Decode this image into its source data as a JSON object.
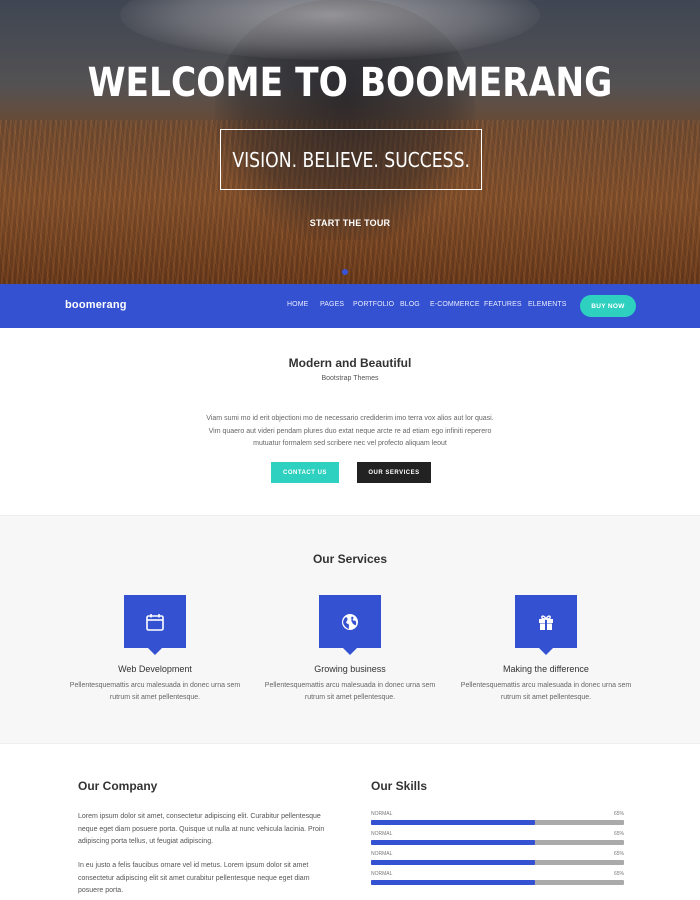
{
  "hero": {
    "title": "WELCOME TO BOOMERANG",
    "tagline": "VISION. BELIEVE. SUCCESS.",
    "link_label": "START THE TOUR"
  },
  "navbar": {
    "logo": "boomerang",
    "items": [
      {
        "label": "HOME"
      },
      {
        "label": "PAGES"
      },
      {
        "label": "PORTFOLIO"
      },
      {
        "label": "BLOG"
      },
      {
        "label": "E-COMMERCE"
      },
      {
        "label": "FEATURES"
      },
      {
        "label": "ELEMENTS"
      }
    ],
    "cta_label": "BUY NOW"
  },
  "intro": {
    "title": "Modern and Beautiful",
    "subtitle": "Bootstrap Themes",
    "text": "Viam sumi mo id erit objectioni mo de necessario crediderim imo terra vox alios aut lor quasi. Vim quaero aut videri pendam plures duo extat neque arcte re ad etiam ego infiniti reperero mutuatur formalem sed scribere nec vel profecto aliquam leout",
    "contact_label": "CONTACT US",
    "services_label": "OUR SERVICES"
  },
  "services": {
    "title": "Our Services",
    "items": [
      {
        "icon": "calendar-icon",
        "name": "Web Development",
        "description": "Pellentesquemattis arcu malesuada in donec urna sem rutrum sit amet pellentesque."
      },
      {
        "icon": "globe-icon",
        "name": "Growing business",
        "description": "Pellentesquemattis arcu malesuada in donec urna sem rutrum sit amet pellentesque."
      },
      {
        "icon": "gift-icon",
        "name": "Making the difference",
        "description": "Pellentesquemattis arcu malesuada in donec urna sem rutrum sit amet pellentesque."
      }
    ]
  },
  "company": {
    "title": "Our Company",
    "paragraphs": [
      "Lorem ipsum dolor sit amet, consectetur adipiscing elit. Curabitur pellentesque neque eget diam posuere porta. Quisque ut nulla at nunc vehicula lacinia. Proin adipiscing porta tellus, ut feugiat adipiscing.",
      "In eu justo a felis faucibus ornare vel id metus. Lorem ipsum dolor sit amet consectetur adipiscing elit sit amet curabitur pellentesque neque eget diam posuere porta."
    ]
  },
  "skills": {
    "title": "Our Skills",
    "items": [
      {
        "label": "NORMAL",
        "percent_label": "65%",
        "value": 0.65
      },
      {
        "label": "NORMAL",
        "percent_label": "65%",
        "value": 0.65
      },
      {
        "label": "NORMAL",
        "percent_label": "65%",
        "value": 0.65
      },
      {
        "label": "NORMAL",
        "percent_label": "65%",
        "value": 0.65
      }
    ]
  },
  "colors": {
    "primary": "#3451d1",
    "accent": "#2ed0bf",
    "dark": "#222222"
  }
}
